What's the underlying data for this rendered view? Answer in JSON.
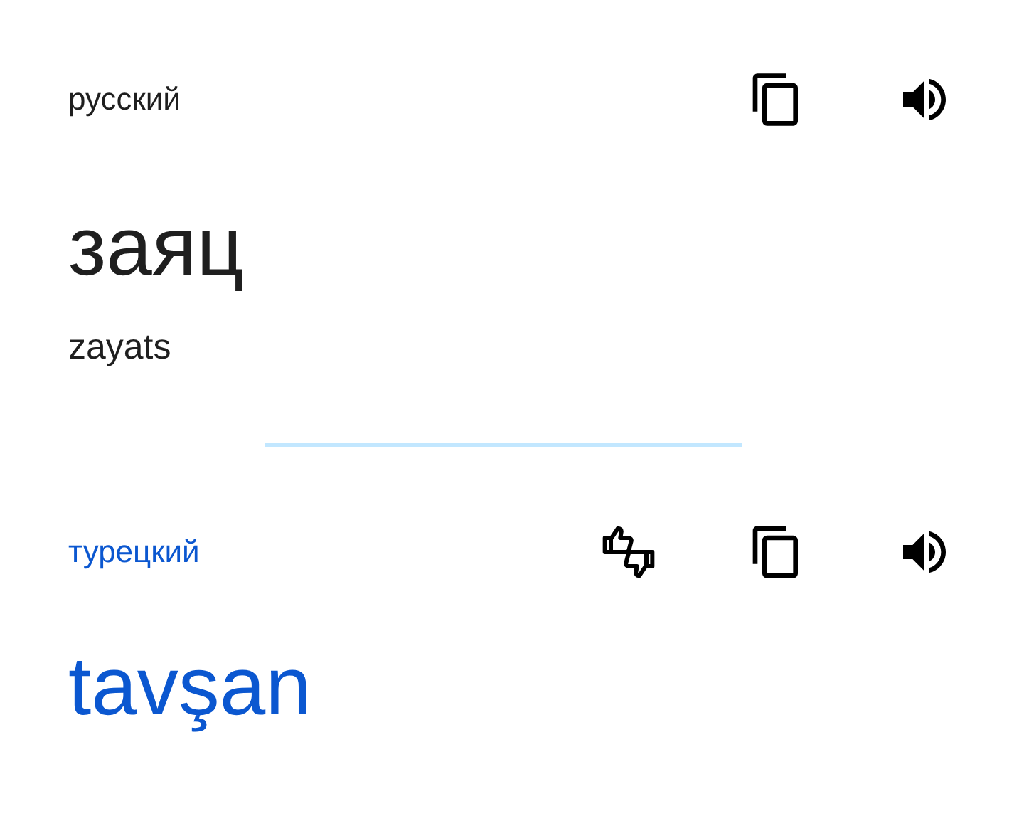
{
  "source": {
    "language": "русский",
    "text": "заяц",
    "transliteration": "zayats"
  },
  "target": {
    "language": "турецкий",
    "text": "tavşan"
  }
}
